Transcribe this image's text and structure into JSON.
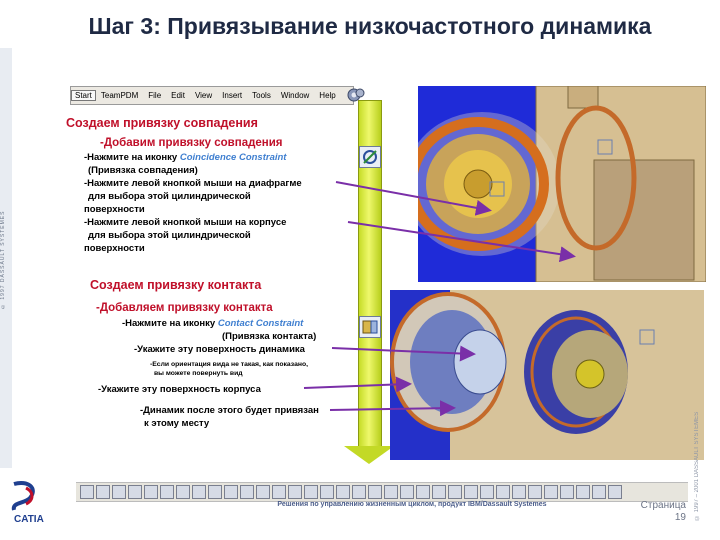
{
  "slide": {
    "title": "Шаг 3: Привязывание низкочастотного динамика",
    "left_vertical_text": "© 1997 DASSAULT SYSTEMES",
    "right_vertical_text": "© 1997 – 2001 DASSAULT SYSTEMES",
    "footer": "Решения по управлению жизненным циклом, продукт IBM/Dassault Systemes",
    "page_label": "Страница",
    "page_number": "19"
  },
  "menubar": {
    "items": [
      "Start",
      "TeamPDM",
      "File",
      "Edit",
      "View",
      "Insert",
      "Tools",
      "Window",
      "Help"
    ]
  },
  "section1": {
    "heading": "Создаем привязку совпадения",
    "subheading": "-Добавим привязку совпадения",
    "line1_prefix": "-Нажмите на иконку",
    "line1_link": "Coincidence Constraint",
    "line2": "(Привязка совпадения)",
    "line3": "-Нажмите левой кнопкой мыши на диафрагме",
    "line4": "для выбора этой цилиндрической",
    "line5": "поверхности",
    "line6": "-Нажмите левой кнопкой мыши на корпусе",
    "line7": "для выбора этой цилиндрической",
    "line8": "поверхности"
  },
  "section2": {
    "heading": "Создаем привязку контакта",
    "subheading": "-Добавляем привязку контакта",
    "line1_prefix": "-Нажмите на иконку",
    "line1_link": "Contact Constraint",
    "line2": "(Привязка контакта)",
    "line3": "-Укажите эту поверхность динамика",
    "note1": "-Если ориентация вида не такая, как показано,",
    "note2": "вы можете повернуть вид",
    "line4": "-Укажите эту поверхность корпуса",
    "line5": "-Динамик после этого будет привязан",
    "line6": "к этому месту"
  },
  "colors": {
    "title": "#1f2a44",
    "heading": "#c0102a",
    "link": "#3f7fd0",
    "arrow": "#c6dc27",
    "pointer": "#7a2fa8"
  },
  "icons": [
    "coincidence-constraint-icon",
    "contact-constraint-icon",
    "gear-icon"
  ]
}
